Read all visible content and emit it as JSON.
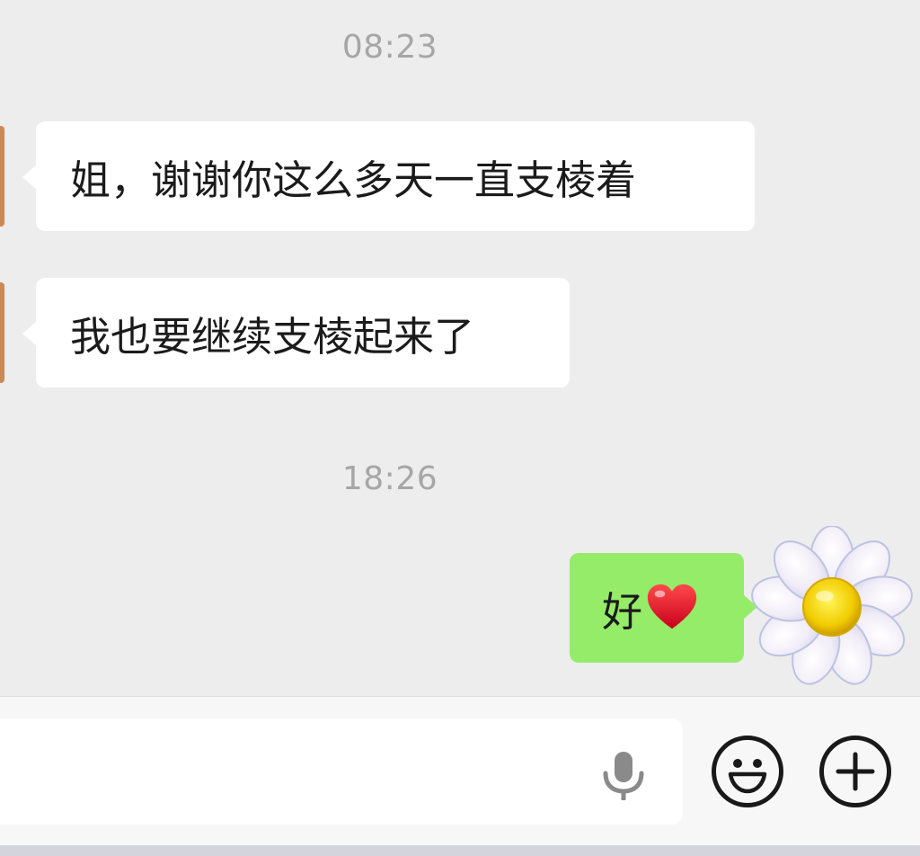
{
  "chat": {
    "timestamp_1": "08:23",
    "message_1": "姐，谢谢你这么多天一直支棱着",
    "message_2": "我也要继续支棱起来了",
    "timestamp_2": "18:26",
    "message_3_text": "好",
    "message_3_emoji": "heart-emoji"
  },
  "avatars": {
    "contact": "contact-avatar",
    "self": "daisy-flower-avatar"
  },
  "input_bar": {
    "text_value": "",
    "icons": [
      "microphone-icon",
      "emoji-smiley-icon",
      "plus-icon"
    ]
  },
  "colors": {
    "background": "#ededed",
    "incoming_bubble": "#ffffff",
    "outgoing_bubble": "#95ec69",
    "timestamp_text": "#a6a6a6"
  }
}
